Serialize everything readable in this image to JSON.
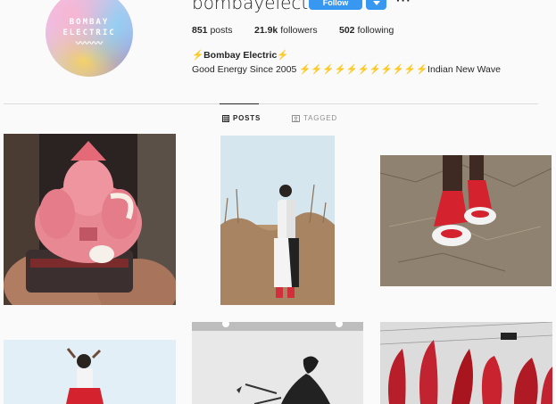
{
  "profile": {
    "username": "bombayelectric",
    "avatar_text_line1": "BOMBAY",
    "avatar_text_line2": "ELECTRIC",
    "avatar_wave": "〰〰〰",
    "follow_label": "Follow",
    "dropdown_icon": "chevron-down-icon",
    "more_label": "···",
    "posts_count": "851",
    "posts_label": "posts",
    "followers_count": "21.9k",
    "followers_label": "followers",
    "following_count": "502",
    "following_label": "following",
    "full_name": "⚡Bombay Electric⚡",
    "bio": "Good Energy Since 2005 ⚡⚡⚡⚡⚡⚡⚡⚡⚡⚡⚡Indian New Wave"
  },
  "tabs": {
    "posts_label": "POSTS",
    "tagged_label": "TAGGED"
  },
  "colors": {
    "accent": "#3897f0",
    "text": "#262626",
    "muted": "#8e8e8e",
    "background": "#fafafa"
  },
  "posts": [
    {
      "subject": "pink ganesha figure held in hands"
    },
    {
      "subject": "person in white outfit standing in dry grass"
    },
    {
      "subject": "feet in red socks and white sandals on dry ground"
    },
    {
      "subject": "person in white top and red skirt against sky"
    },
    {
      "subject": "black and white ink splash figure"
    },
    {
      "subject": "red sculptural installation"
    }
  ]
}
